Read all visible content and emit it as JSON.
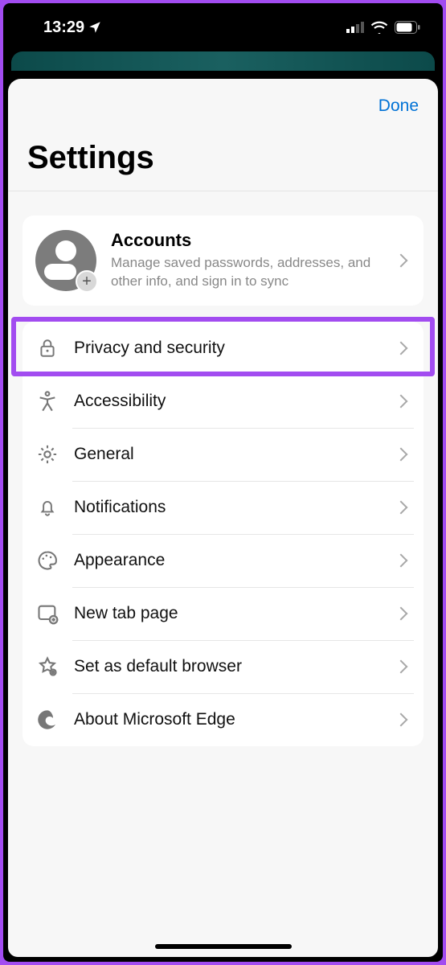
{
  "status": {
    "time": "13:29"
  },
  "nav": {
    "done": "Done"
  },
  "page": {
    "title": "Settings"
  },
  "accounts": {
    "title": "Accounts",
    "subtitle": "Manage saved passwords, addresses, and other info, and sign in to sync"
  },
  "rows": {
    "privacy": "Privacy and security",
    "accessibility": "Accessibility",
    "general": "General",
    "notifications": "Notifications",
    "appearance": "Appearance",
    "newtab": "New tab page",
    "default": "Set as default browser",
    "about": "About Microsoft Edge"
  }
}
